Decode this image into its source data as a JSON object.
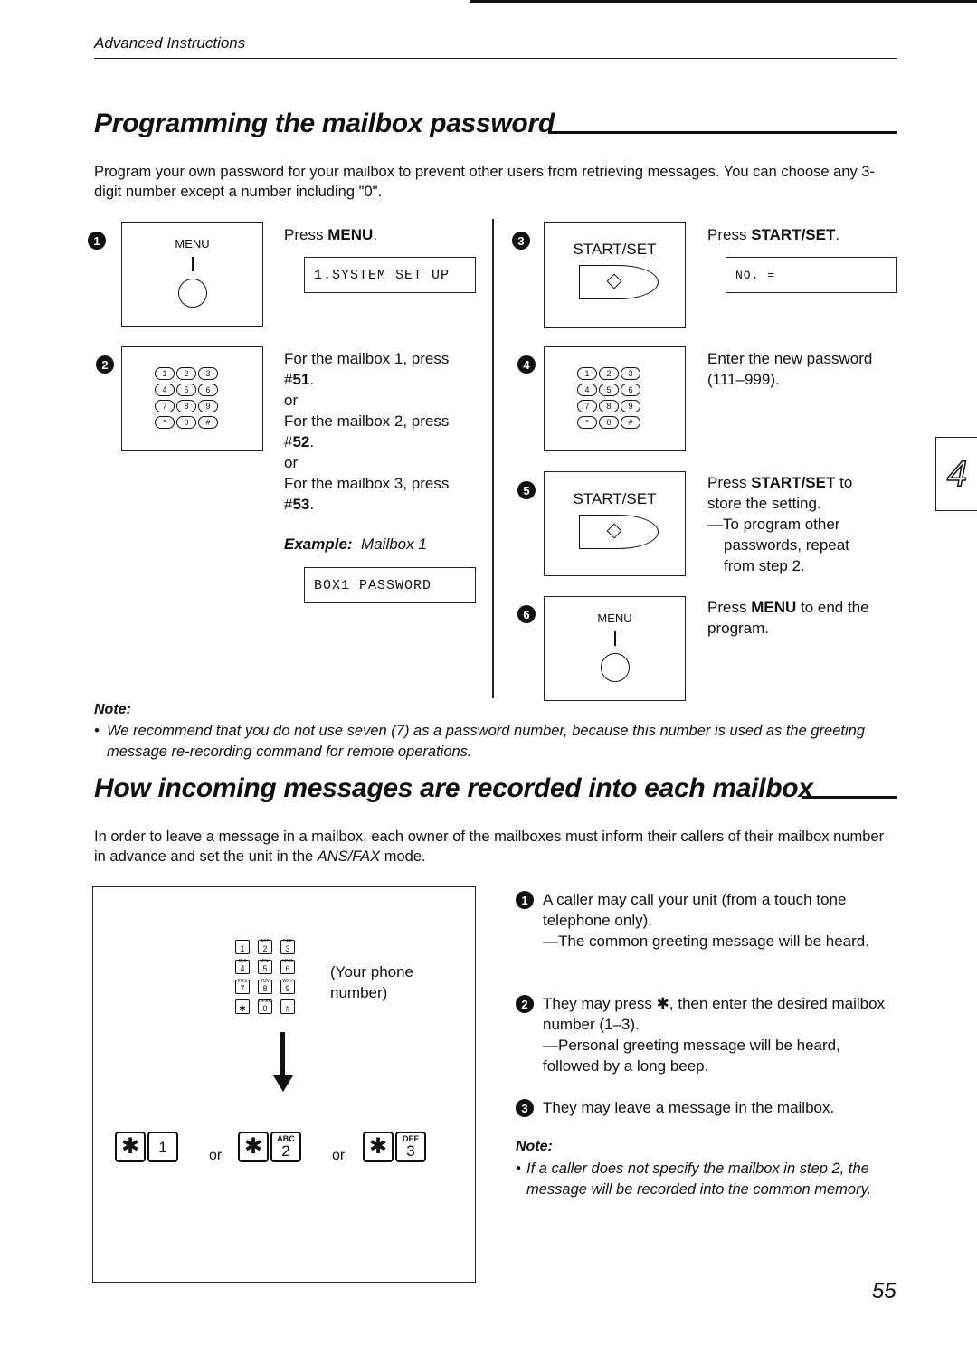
{
  "header": {
    "section_label": "Advanced Instructions"
  },
  "section1": {
    "title": "Programming the mailbox password",
    "intro": "Program your own password for your mailbox to prevent other users from retrieving messages. You can choose any 3-digit number except a number including \"0\".",
    "steps": [
      {
        "number": "1",
        "panel": {
          "type": "menu-button",
          "label": "MENU"
        },
        "text_prefix": "Press ",
        "text_bold": "MENU",
        "text_suffix": ".",
        "lcd": "1.SYSTEM SET UP"
      },
      {
        "number": "2",
        "panel": {
          "type": "dial-keypad",
          "keys": [
            "1",
            "2",
            "3",
            "4",
            "5",
            "6",
            "7",
            "8",
            "9",
            "*",
            "0",
            "#"
          ]
        },
        "options": [
          {
            "text": "For the mailbox 1, press",
            "code_prefix": "#",
            "code_bold": "51",
            "code_suffix": "."
          },
          {
            "text": "For the mailbox 2, press",
            "code_prefix": "#",
            "code_bold": "52",
            "code_suffix": "."
          },
          {
            "text": "For the mailbox 3, press",
            "code_prefix": "#",
            "code_bold": "53",
            "code_suffix": "."
          }
        ],
        "or_label": "or",
        "example_label": "Example:",
        "example_value": "Mailbox 1",
        "lcd": "BOX1 PASSWORD"
      },
      {
        "number": "3",
        "panel": {
          "type": "start-set-button",
          "label": "START/SET"
        },
        "text_prefix": "Press ",
        "text_bold": "START/SET",
        "text_suffix": ".",
        "lcd": "NO. ="
      },
      {
        "number": "4",
        "panel": {
          "type": "dial-keypad",
          "keys": [
            "1",
            "2",
            "3",
            "4",
            "5",
            "6",
            "7",
            "8",
            "9",
            "*",
            "0",
            "#"
          ]
        },
        "text_line1": "Enter the new password",
        "text_line2": "(111–999)."
      },
      {
        "number": "5",
        "panel": {
          "type": "start-set-button",
          "label": "START/SET"
        },
        "text_prefix": "Press ",
        "text_bold": "START/SET",
        "text_suffix": " to",
        "text_line2": "store the setting.",
        "sub_line1": "—To program other",
        "sub_line2": "passwords, repeat",
        "sub_line3": "from step 2."
      },
      {
        "number": "6",
        "panel": {
          "type": "menu-button",
          "label": "MENU"
        },
        "text_prefix": "Press ",
        "text_bold": "MENU",
        "text_suffix": " to end the",
        "text_line2": "program."
      }
    ],
    "note": {
      "heading": "Note:",
      "bullet": "We recommend that you do not use seven (7) as a password number, because this number is used as the greeting message re-recording command for remote operations."
    }
  },
  "chapter_tab": "4",
  "section2": {
    "title": "How incoming messages are recorded into each mailbox",
    "intro_prefix": "In order to leave a message in a mailbox, each owner of the mailboxes must inform their callers of their mailbox number in advance and set the unit in the ",
    "intro_italic": "ANS/FAX",
    "intro_suffix": " mode.",
    "diagram": {
      "keypad_keys": [
        {
          "sub": "",
          "num": "1"
        },
        {
          "sub": "ABC",
          "num": "2"
        },
        {
          "sub": "DEF",
          "num": "3"
        },
        {
          "sub": "GHI",
          "num": "4"
        },
        {
          "sub": "JKL",
          "num": "5"
        },
        {
          "sub": "MNO",
          "num": "6"
        },
        {
          "sub": "PRS",
          "num": "7"
        },
        {
          "sub": "TUV",
          "num": "8"
        },
        {
          "sub": "WXY",
          "num": "9"
        },
        {
          "sub": "",
          "num": "✱"
        },
        {
          "sub": "OPER",
          "num": "0"
        },
        {
          "sub": "",
          "num": "#"
        }
      ],
      "phone_label_line1": "(Your phone",
      "phone_label_line2": "number)",
      "combos": [
        {
          "star": "✱",
          "sub": "",
          "num": "1"
        },
        {
          "star": "✱",
          "sub": "ABC",
          "num": "2"
        },
        {
          "star": "✱",
          "sub": "DEF",
          "num": "3"
        }
      ],
      "or_label": "or"
    },
    "steps": [
      {
        "number": "1",
        "text": "A caller may call your unit (from a touch tone telephone only).",
        "sub": "—The common greeting message will be heard."
      },
      {
        "number": "2",
        "text": "They may press ✱, then enter the desired mailbox number (1–3).",
        "sub": "—Personal greeting message will be heard, followed by a long beep."
      },
      {
        "number": "3",
        "text": "They may leave a message in the mailbox.",
        "sub": ""
      }
    ],
    "note": {
      "heading": "Note:",
      "bullet": "If a caller does not specify the mailbox in step 2, the message will be recorded into the common memory."
    }
  },
  "footer": {
    "page_number": "55"
  }
}
